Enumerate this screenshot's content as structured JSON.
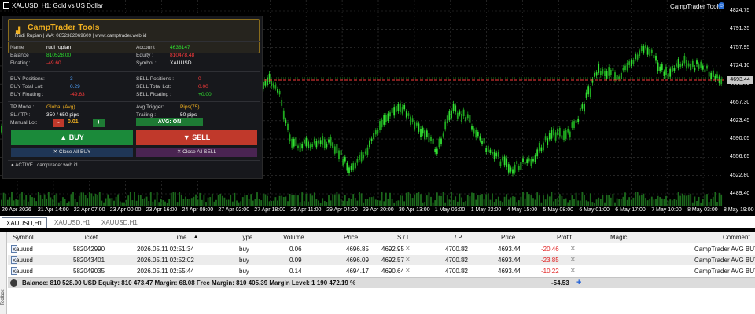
{
  "chart": {
    "title": "XAUUSD, H1:  Gold vs US Dollar",
    "ea_name": "CampTrader Tools",
    "current_price": "4693.44",
    "price_labels": [
      "4824.75",
      "4791.35",
      "4757.95",
      "4724.10",
      "4690.70",
      "4657.30",
      "4623.45",
      "4590.05",
      "4556.65",
      "4522.80",
      "4489.40"
    ],
    "time_labels": [
      "20 Apr 2026",
      "21 Apr 14:00",
      "22 Apr 07:00",
      "23 Apr 00:00",
      "23 Apr 16:00",
      "24 Apr 09:00",
      "27 Apr 02:00",
      "27 Apr 18:00",
      "28 Apr 11:00",
      "29 Apr 04:00",
      "29 Apr 20:00",
      "30 Apr 13:00",
      "1 May 06:00",
      "1 May 22:00",
      "4 May 15:00",
      "5 May 08:00",
      "6 May 01:00",
      "6 May 17:00",
      "7 May 10:00",
      "8 May 03:00",
      "8 May 19:00"
    ],
    "colors": {
      "candle_up": "#32e032",
      "candle_down": "#1faa1f",
      "volume": "#1c6a1c",
      "grid": "#3a3a3a",
      "bid_line": "#ff3b3b",
      "entry_line": "#2ee02e"
    }
  },
  "panel": {
    "title": "CampTrader Tools",
    "subtitle": "Rudi Rupian | WA: 0852382069609 | www.camptrader.web.id",
    "name_label": "Name",
    "name": "rudi rupian",
    "balance_label": "Balance :",
    "balance": "810528.00",
    "floating_label": "Floating:",
    "floating": "-49.60",
    "account_label": "Account :",
    "account": "4638147",
    "equity_label": "Equity :",
    "equity": "810478.48",
    "symbol_label": "Symbol :",
    "symbol": "XAUUSD",
    "buy_positions_label": "BUY  Positions:",
    "buy_positions": "3",
    "buy_total_lot_label": "BUY  Total Lot:",
    "buy_total_lot": "0.29",
    "buy_floating_label": "BUY  Floating :",
    "buy_floating": "-49.63",
    "sell_positions_label": "SELL Positions :",
    "sell_positions": "0",
    "sell_total_lot_label": "SELL Total Lot:",
    "sell_total_lot": "0.00",
    "sell_floating_label": "SELL Floating :",
    "sell_floating": "+0.00",
    "tp_mode_label": "TP Mode  :",
    "tp_mode": "Global (Avg)",
    "sltp_label": "SL / TP  :",
    "sltp": "350 / 650 pips",
    "avg_trigger_label": "Avg Trigger:",
    "avg_trigger": "Pips(75)",
    "trailing_label": "Trailing  :",
    "trailing": "50 pips",
    "manual_lot_label": "Manual Lot:",
    "minus": "-",
    "lot": "0.01",
    "plus": "+",
    "avg_status": "AVG: ON",
    "buy_label": "▲  BUY",
    "sell_label": "▼  SELL",
    "close_buy_label": "✕ Close All BUY",
    "close_sell_label": "✕ Close All SELL",
    "footer": "● ACTIVE | camptrader.web.id"
  },
  "tabs": [
    "XAUUSD,H1",
    "XAUUSD,H1",
    "XAUUSD,H1"
  ],
  "table": {
    "headers": {
      "symbol": "Symbol",
      "ticket": "Ticket",
      "time": "Time",
      "type": "Type",
      "volume": "Volume",
      "price": "Price",
      "sl": "S / L",
      "tp": "T / P",
      "price2": "Price",
      "profit": "Profit",
      "magic": "Magic",
      "comment": "Comment"
    },
    "rows": [
      {
        "symbol": "xauusd",
        "ticket": "582042990",
        "time": "2026.05.11 02:51:34",
        "type": "buy",
        "volume": "0.06",
        "price": "4696.85",
        "sl": "4692.95",
        "tp": "4700.82",
        "price2": "4693.44",
        "profit": "-20.46",
        "comment": "CampTrader AVG BUY"
      },
      {
        "symbol": "xauusd",
        "ticket": "582043401",
        "time": "2026.05.11 02:52:02",
        "type": "buy",
        "volume": "0.09",
        "price": "4696.09",
        "sl": "4692.57",
        "tp": "4700.82",
        "price2": "4693.44",
        "profit": "-23.85",
        "comment": "CampTrader AVG BUY"
      },
      {
        "symbol": "xauusd",
        "ticket": "582049035",
        "time": "2026.05.11 02:55:44",
        "type": "buy",
        "volume": "0.14",
        "price": "4694.17",
        "sl": "4690.64",
        "tp": "4700.82",
        "price2": "4693.44",
        "profit": "-10.22",
        "comment": "CampTrader AVG BUY"
      }
    ],
    "summary": "Balance: 810 528.00 USD  Equity: 810 473.47  Margin: 68.08  Free Margin: 810 405.39  Margin Level: 1 190 472.19 %",
    "summary_profit": "-54.53",
    "toolbox": "Toolbox"
  }
}
